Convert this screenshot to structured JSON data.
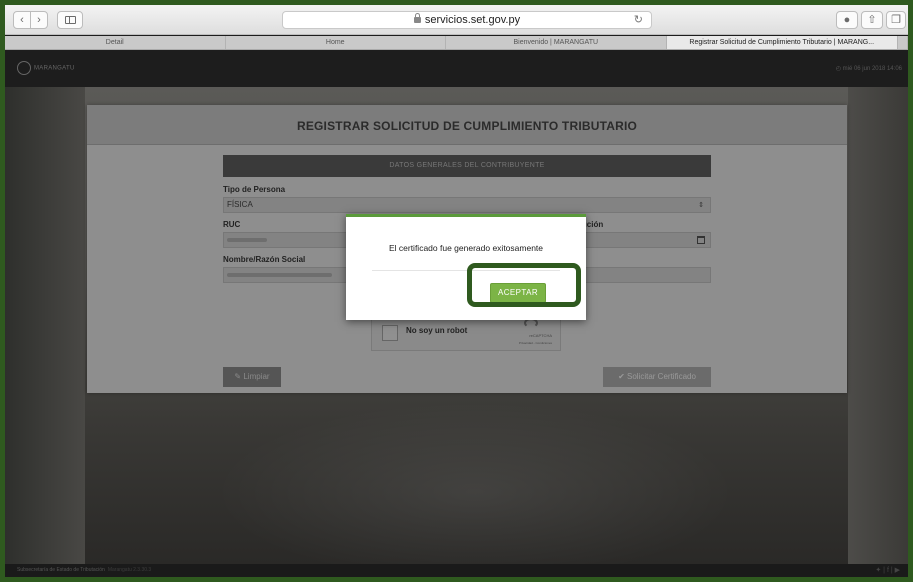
{
  "browser": {
    "url": "servicios.set.gov.py",
    "tabs": [
      {
        "label": "Detail"
      },
      {
        "label": "Home"
      },
      {
        "label": "Bienvenido | MARANGATU"
      },
      {
        "label": "Registrar Solicitud de Cumplimiento Tributario | MARANG..."
      }
    ]
  },
  "header": {
    "brand": "MARANGATU",
    "date": "mié 06 jun 2018 14:06"
  },
  "form": {
    "title": "REGISTRAR SOLICITUD DE CUMPLIMIENTO TRIBUTARIO",
    "section": "DATOS GENERALES DEL CONTRIBUYENTE",
    "tipo_persona_label": "Tipo de Persona",
    "tipo_persona_value": "FÍSICA",
    "ruc_label": "RUC",
    "constitucion_label": "nstitución",
    "nombre_label": "Nombre/Razón Social",
    "captcha_text": "No soy un robot",
    "captcha_brand": "reCAPTCHA",
    "captcha_sub": "Privacidad - Condiciones",
    "clear_label": "Limpiar",
    "request_label": "Solicitar Certificado"
  },
  "modal": {
    "message": "El certificado fue generado exitosamente",
    "accept_label": "ACEPTAR"
  },
  "footer": {
    "text": "Subsecretaría de Estado de Tributación",
    "version": "Marangatu 2.3.30.3"
  },
  "colors": {
    "accent_green": "#7cb446",
    "highlight": "#2f5a1f"
  }
}
